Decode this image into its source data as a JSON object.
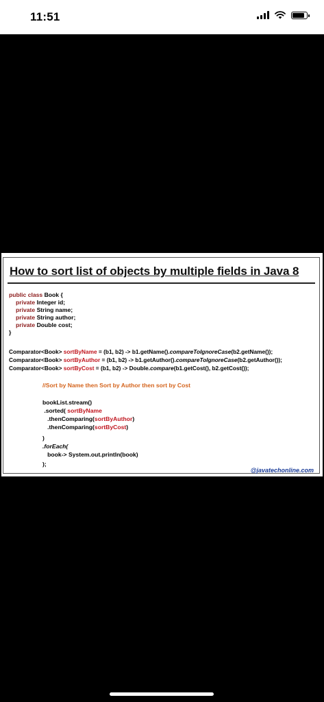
{
  "status_bar": {
    "time": "11:51"
  },
  "post": {
    "title": "How to sort list of objects by multiple fields in Java 8",
    "class_block": {
      "decl_kw": "public class ",
      "decl_name": "Book {",
      "fields": [
        {
          "kw": "private ",
          "text": "Integer id;"
        },
        {
          "kw": "private ",
          "text": "String name;"
        },
        {
          "kw": "private ",
          "text": "String author;"
        },
        {
          "kw": "private ",
          "text": "Double cost;"
        }
      ],
      "close": "}"
    },
    "comparators": [
      {
        "type": "Comparator<Book> ",
        "name": "sortByName",
        "lambda": " = (b1, b2) -> b1.getName().",
        "method": "compareToIgnoreCase",
        "rest": "(b2.getName());"
      },
      {
        "type": "Comparator<Book> ",
        "name": "sortByAuthor",
        "lambda": " = (b1, b2) -> b1.getAuthor().",
        "method": "compareToIgnoreCase",
        "rest": "(b2.getAuthor());"
      },
      {
        "type": "Comparator<Book> ",
        "name": "sortByCost",
        "lambda": " = (b1, b2) -> Double.",
        "method": "compare",
        "rest": "(b1.getCost(), b2.getCost());"
      }
    ],
    "comment": "//Sort by Name then Sort by Author then sort by Cost",
    "stream": {
      "line1": "bookList.stream()",
      "line2_pre": " .sorted( ",
      "line2_arg": "sortByName",
      "line3_pre": "   .thenComparing(",
      "line3_arg": "sortByAuthor",
      "line3_post": ")",
      "line4_pre": "   .thenComparing(",
      "line4_arg": "sortByCost",
      "line4_post": ")",
      "line5": ")",
      "line6": ".forEach(",
      "line7": "   book-> System.out.println(book)",
      "line8": ");"
    },
    "watermark": "@javatechonline.com"
  },
  "colors": {
    "keyword": "#8b1a1a",
    "identifier": "#c0161f",
    "comment": "#d4631b",
    "link": "#1a3c99"
  }
}
